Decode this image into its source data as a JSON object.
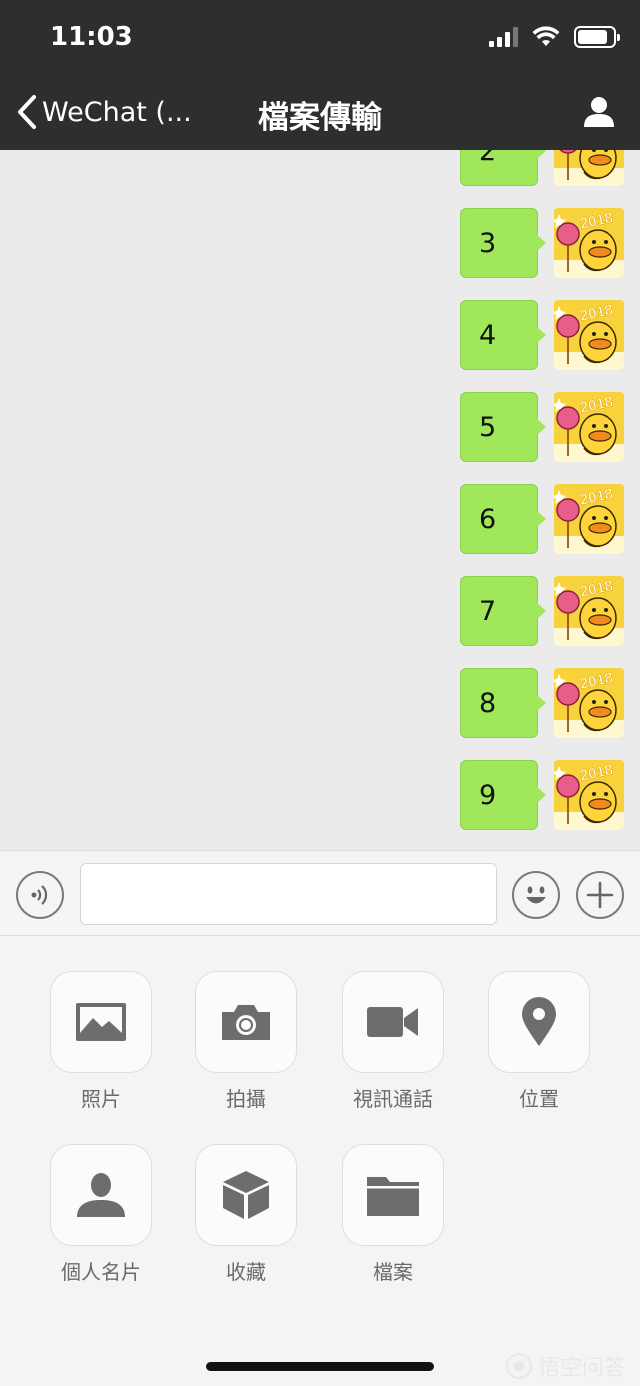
{
  "status_bar": {
    "time": "11:03",
    "battery_level": 0.85
  },
  "nav": {
    "back_label": "WeChat (...",
    "title": "檔案傳輸",
    "profile_icon": "person-icon"
  },
  "messages": [
    {
      "text": "2"
    },
    {
      "text": "3"
    },
    {
      "text": "4"
    },
    {
      "text": "5"
    },
    {
      "text": "6"
    },
    {
      "text": "7"
    },
    {
      "text": "8"
    },
    {
      "text": "9"
    }
  ],
  "avatar_badge": "2018",
  "input_bar": {
    "voice_icon": "voice-icon",
    "emoji_icon": "emoji-icon",
    "plus_icon": "plus-icon",
    "value": ""
  },
  "tools": [
    {
      "label": "照片",
      "icon": "photo-icon"
    },
    {
      "label": "拍攝",
      "icon": "camera-icon"
    },
    {
      "label": "視訊通話",
      "icon": "video-call-icon"
    },
    {
      "label": "位置",
      "icon": "location-icon"
    },
    {
      "label": "個人名片",
      "icon": "contact-card-icon"
    },
    {
      "label": "收藏",
      "icon": "favorites-icon"
    },
    {
      "label": "檔案",
      "icon": "folder-icon"
    }
  ],
  "watermark": {
    "text": "悟空问答"
  },
  "colors": {
    "bubble": "#a0e75a",
    "nav_bg": "#2e2e2e",
    "icon_gray": "#6d6d70"
  }
}
